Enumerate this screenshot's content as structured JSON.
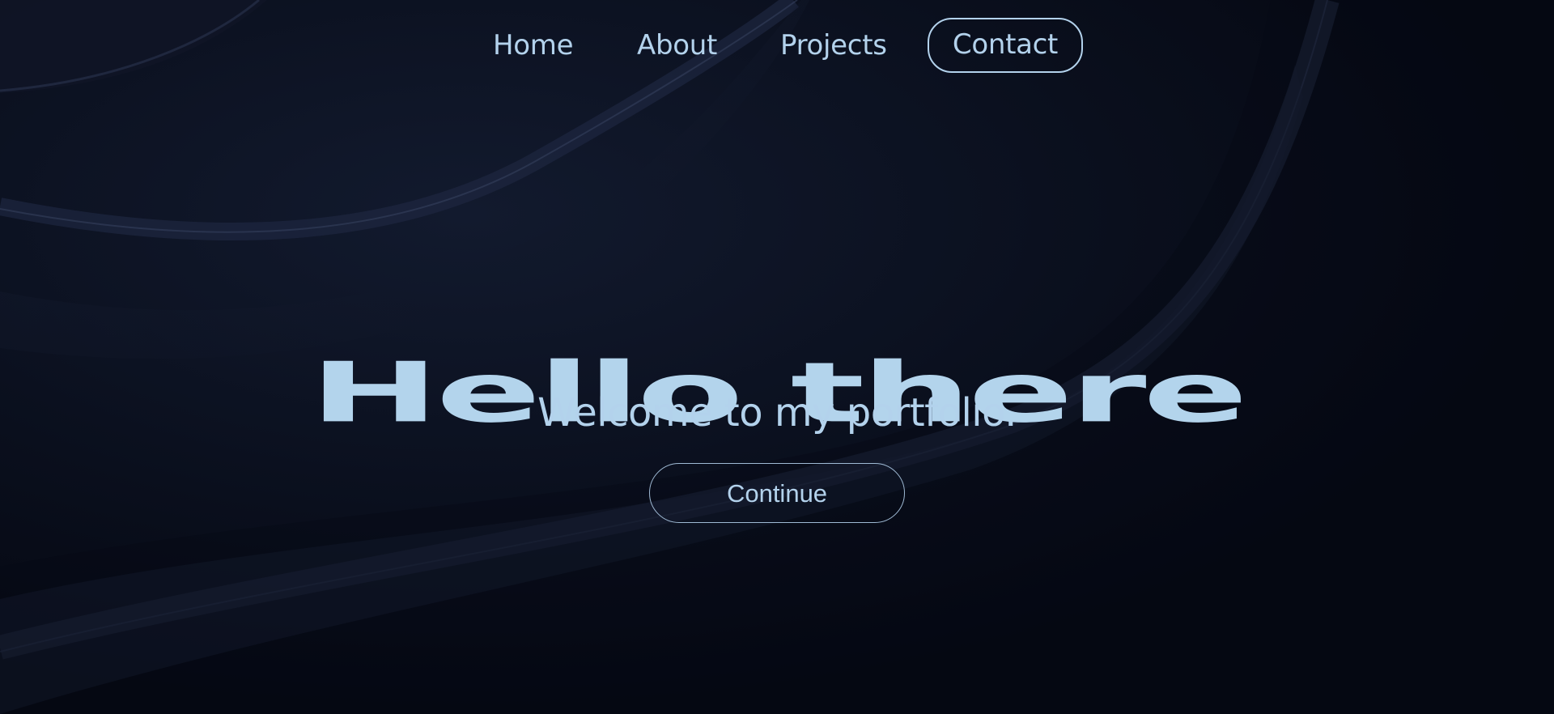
{
  "nav": {
    "items": [
      {
        "label": "Home"
      },
      {
        "label": "About"
      },
      {
        "label": "Projects"
      },
      {
        "label": "Contact"
      }
    ]
  },
  "hero": {
    "title": "Hello there",
    "subtitle": "Welcome to my portfolio.",
    "cta_label": "Continue"
  },
  "colors": {
    "background": "#060a15",
    "accent": "#b3d2ec",
    "swirl": "#1a2236"
  }
}
